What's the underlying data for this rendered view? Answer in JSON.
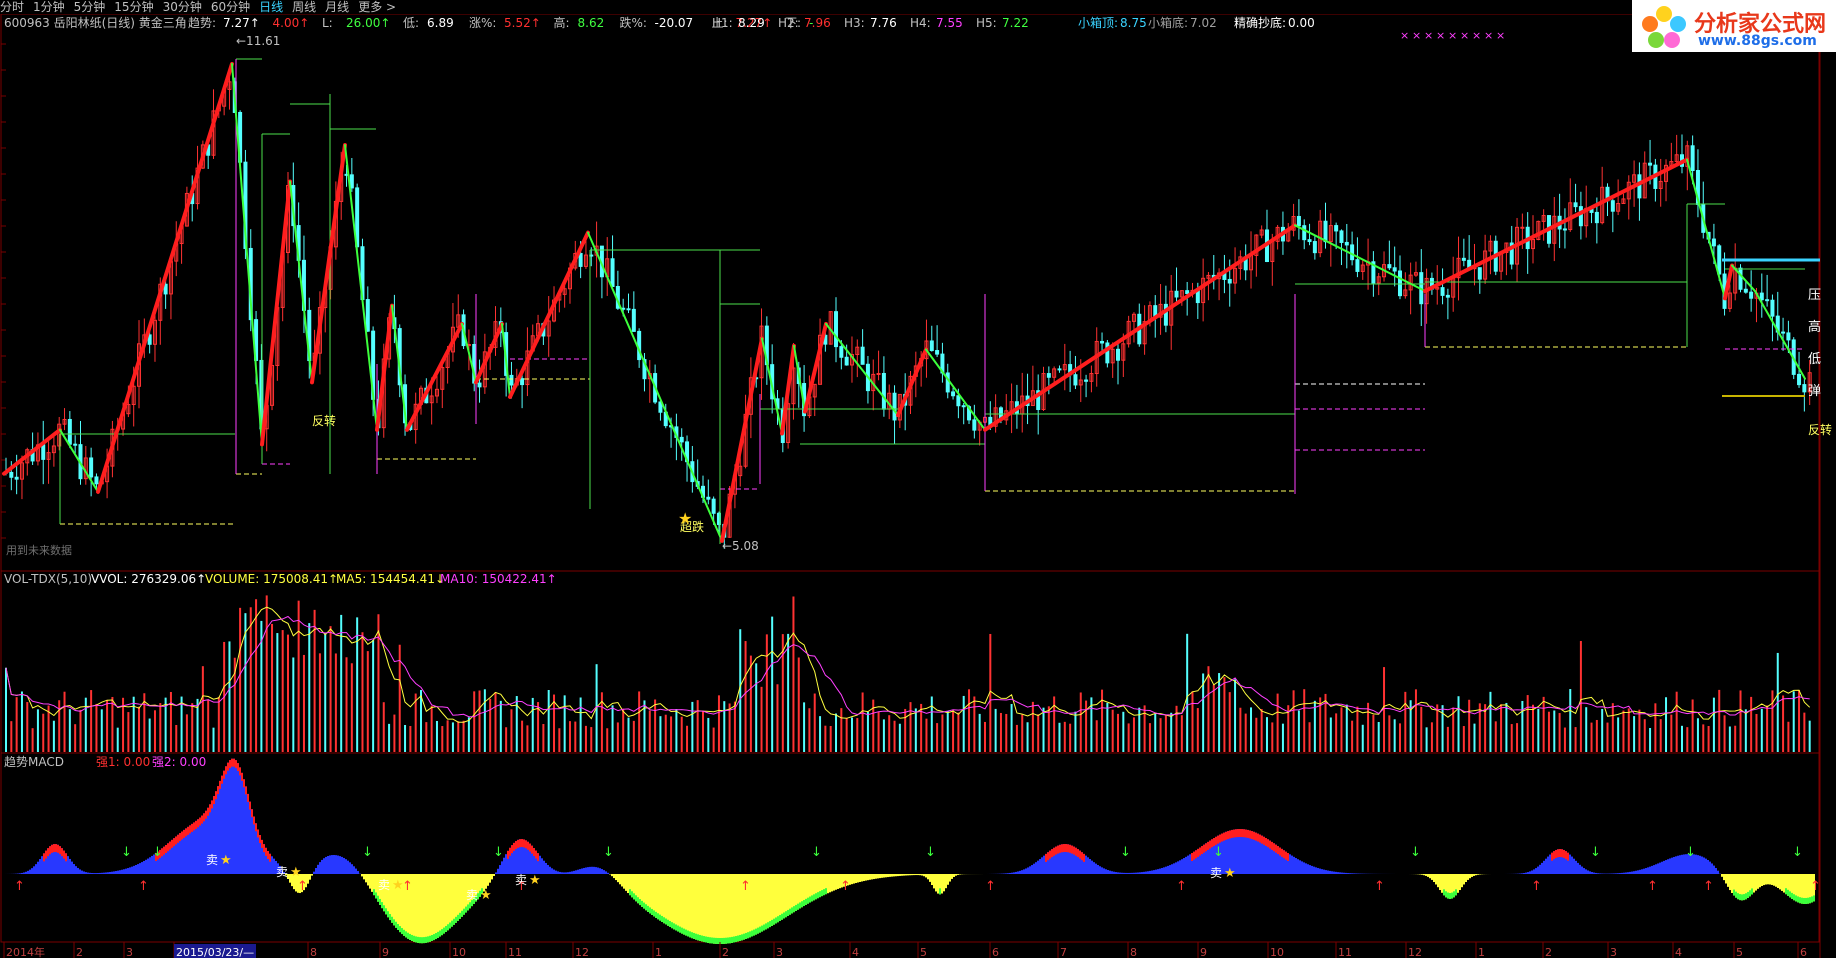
{
  "toolbar": {
    "timeframes": [
      "分时",
      "1分钟",
      "5分钟",
      "15分钟",
      "30分钟",
      "60分钟",
      "日线",
      "周线",
      "月线"
    ],
    "active": "日线",
    "more": "更多 >"
  },
  "main": {
    "title": "600963 岳阳林纸(日线) 黄金三角",
    "fields": [
      {
        "label": "趋势:",
        "value": "7.27↑",
        "color": "#ffffff"
      },
      {
        "label": "",
        "value": "4.00↑",
        "color": "#ff3030"
      },
      {
        "label": "L:",
        "value": "26.00↑",
        "color": "#40ff40"
      },
      {
        "label": "低:",
        "value": "6.89",
        "color": "#ffffff"
      },
      {
        "label": "涨%:",
        "value": "5.52↑",
        "color": "#ff3030"
      },
      {
        "label": "高:",
        "value": "8.62",
        "color": "#40ff40"
      },
      {
        "label": "跌%:",
        "value": "-20.07",
        "color": "#ffffff"
      },
      {
        "label": "上:",
        "value": "7.27↑",
        "color": "#ff3030"
      },
      {
        "label": "下:",
        "value": "-",
        "color": "#40ff40"
      }
    ],
    "h_fields": [
      {
        "label": "H1:",
        "value": "8.29",
        "color": "#ffffff"
      },
      {
        "label": "H2:",
        "value": "7.96",
        "color": "#ff3030"
      },
      {
        "label": "H3:",
        "value": "7.76",
        "color": "#ffffff"
      },
      {
        "label": "H4:",
        "value": "7.55",
        "color": "#ff40ff"
      },
      {
        "label": "H5:",
        "value": "7.22",
        "color": "#40ff40"
      }
    ],
    "box_top": {
      "label": "小箱顶:",
      "value": "8.75",
      "color": "#3ad3ff"
    },
    "box_bottom": {
      "label": "小箱底:",
      "value": "7.02",
      "color": "#a0a0a0"
    },
    "precise_bottom": {
      "label": "精确抄底:",
      "value": "0.00",
      "color": "#ffffff"
    },
    "max_label": "←11.61",
    "min_label": "←5.08",
    "annotations": [
      "反转",
      "超跌",
      "反转"
    ],
    "right_labels": [
      "压",
      "高",
      "低",
      "弹"
    ],
    "legacy_note": "用到未来数据"
  },
  "volume": {
    "indicator": "VOL-TDX(5,10)",
    "vvol": "VVOL: 276329.06↑",
    "volume": "VOLUME: 175008.41↑",
    "ma5": "MA5: 154454.41↓",
    "ma10": "MA10: 150422.41↑",
    "colors": {
      "vvol": "#ffffff",
      "volume": "#ffff40",
      "ma5": "#ffff40",
      "ma10": "#ff40ff"
    }
  },
  "macd": {
    "title": "趋势MACD",
    "strong1": "强1: 0.00",
    "strong2": "强2: 0.00",
    "sell_label": "卖",
    "colors": {
      "strong1": "#ff3030",
      "strong2": "#ff40ff"
    }
  },
  "xaxis": {
    "labels": [
      "2014年",
      "2",
      "3",
      "2015/03/23/—",
      "8",
      "9",
      "10",
      "11",
      "12",
      "1",
      "2",
      "3",
      "4",
      "5",
      "6",
      "7",
      "8",
      "9",
      "10",
      "11",
      "12",
      "1",
      "2",
      "3",
      "4",
      "5",
      "6"
    ]
  },
  "logo": {
    "text": "分析家公式网",
    "url": "www.88gs.com"
  },
  "colors": {
    "up": "#ff3232",
    "down": "#54ffff",
    "rise_line": "#ff1e1e",
    "fall_line": "#3cff3c",
    "grid": "#7a0000"
  }
}
